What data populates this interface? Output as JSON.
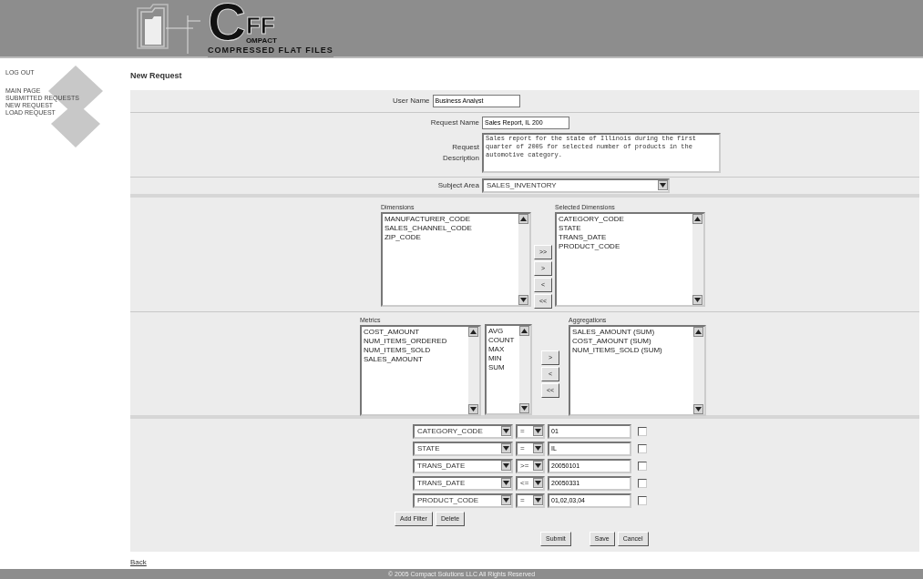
{
  "logo": {
    "big_letter": "C",
    "letters": "FF",
    "subtitle": "OMPACT",
    "tagline": "COMPRESSED FLAT FILES"
  },
  "sidebar": {
    "items": [
      {
        "label": "LOG OUT"
      },
      {
        "label": "MAIN PAGE"
      },
      {
        "label": "SUBMITTED REQUESTS"
      },
      {
        "label": "NEW REQUEST"
      },
      {
        "label": "LOAD REQUEST"
      }
    ]
  },
  "page_title": "New Request",
  "form": {
    "user_name": {
      "label": "User Name",
      "value": "Business Analyst"
    },
    "request_name": {
      "label": "Request Name",
      "value": "Sales Report, IL 200"
    },
    "request_description": {
      "label": "Request Description",
      "value": "Sales report for the state of Illinois during the first quarter of 2005 for selected number of products in the automotive category."
    },
    "subject_area": {
      "label": "Subject Area",
      "value": "SALES_INVENTORY"
    },
    "dimensions": {
      "label": "Dimensions",
      "items": [
        "MANUFACTURER_CODE",
        "SALES_CHANNEL_CODE",
        "ZIP_CODE"
      ]
    },
    "dimension_buttons": [
      ">>",
      ">",
      "<",
      "<<"
    ],
    "selected_dimensions": {
      "label": "Selected Dimensions",
      "items": [
        "CATEGORY_CODE",
        "STATE",
        "TRANS_DATE",
        "PRODUCT_CODE"
      ]
    },
    "metrics": {
      "label": "Metrics",
      "items": [
        "COST_AMOUNT",
        "NUM_ITEMS_ORDERED",
        "NUM_ITEMS_SOLD",
        "SALES_AMOUNT"
      ]
    },
    "functions": {
      "items": [
        "AVG",
        "COUNT",
        "MAX",
        "MIN",
        "SUM"
      ]
    },
    "metric_buttons": [
      ">",
      "<",
      "<<"
    ],
    "aggregations": {
      "label": "Aggregations",
      "items": [
        "SALES_AMOUNT (SUM)",
        "COST_AMOUNT (SUM)",
        "NUM_ITEMS_SOLD (SUM)"
      ]
    },
    "filters": [
      {
        "field": "CATEGORY_CODE",
        "operator": "=",
        "value": "01",
        "checked": false
      },
      {
        "field": "STATE",
        "operator": "=",
        "value": "IL",
        "checked": false
      },
      {
        "field": "TRANS_DATE",
        "operator": ">=",
        "value": "20050101",
        "checked": false
      },
      {
        "field": "TRANS_DATE",
        "operator": "<=",
        "value": "20050331",
        "checked": false
      },
      {
        "field": "PRODUCT_CODE",
        "operator": "=",
        "value": "01,02,03,04",
        "checked": false
      }
    ],
    "filter_buttons": [
      "Add Filter",
      "Delete"
    ],
    "action_buttons": [
      "Submit",
      "Save",
      "Cancel"
    ]
  },
  "back_link": "Back",
  "footer": "© 2005 Compact Solutions LLC All Rights Reserved"
}
